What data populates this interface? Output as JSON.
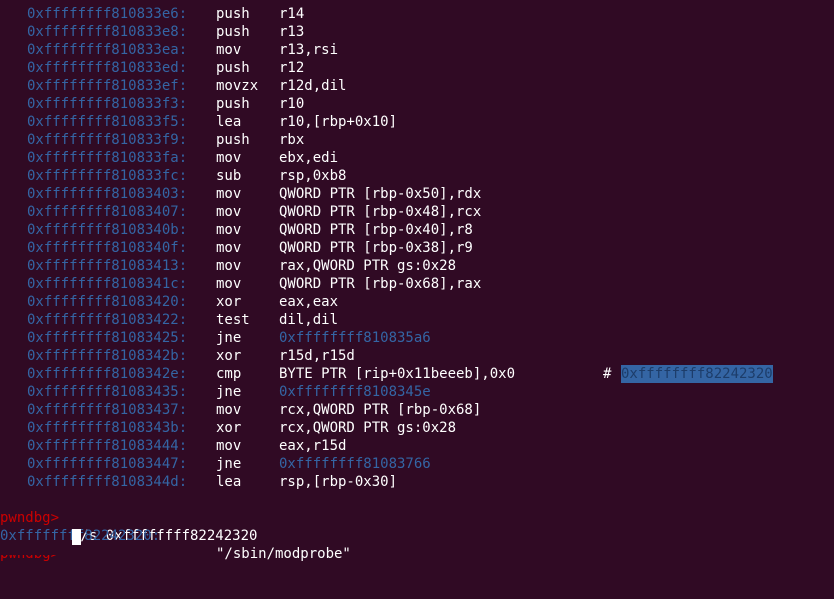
{
  "disassembly": [
    {
      "addr": "0xffffffff810833e6:",
      "mnem": "push",
      "ops": "r14"
    },
    {
      "addr": "0xffffffff810833e8:",
      "mnem": "push",
      "ops": "r13"
    },
    {
      "addr": "0xffffffff810833ea:",
      "mnem": "mov",
      "ops": "r13,rsi"
    },
    {
      "addr": "0xffffffff810833ed:",
      "mnem": "push",
      "ops": "r12"
    },
    {
      "addr": "0xffffffff810833ef:",
      "mnem": "movzx",
      "ops": "r12d,dil"
    },
    {
      "addr": "0xffffffff810833f3:",
      "mnem": "push",
      "ops": "r10"
    },
    {
      "addr": "0xffffffff810833f5:",
      "mnem": "lea",
      "ops": "r10,[rbp+0x10]"
    },
    {
      "addr": "0xffffffff810833f9:",
      "mnem": "push",
      "ops": "rbx"
    },
    {
      "addr": "0xffffffff810833fa:",
      "mnem": "mov",
      "ops": "ebx,edi"
    },
    {
      "addr": "0xffffffff810833fc:",
      "mnem": "sub",
      "ops": "rsp,0xb8"
    },
    {
      "addr": "0xffffffff81083403:",
      "mnem": "mov",
      "ops": "QWORD PTR [rbp-0x50],rdx"
    },
    {
      "addr": "0xffffffff81083407:",
      "mnem": "mov",
      "ops": "QWORD PTR [rbp-0x48],rcx"
    },
    {
      "addr": "0xffffffff8108340b:",
      "mnem": "mov",
      "ops": "QWORD PTR [rbp-0x40],r8"
    },
    {
      "addr": "0xffffffff8108340f:",
      "mnem": "mov",
      "ops": "QWORD PTR [rbp-0x38],r9"
    },
    {
      "addr": "0xffffffff81083413:",
      "mnem": "mov",
      "ops": "rax,QWORD PTR gs:0x28"
    },
    {
      "addr": "0xffffffff8108341c:",
      "mnem": "mov",
      "ops": "QWORD PTR [rbp-0x68],rax"
    },
    {
      "addr": "0xffffffff81083420:",
      "mnem": "xor",
      "ops": "eax,eax"
    },
    {
      "addr": "0xffffffff81083422:",
      "mnem": "test",
      "ops": "dil,dil"
    },
    {
      "addr": "0xffffffff81083425:",
      "mnem": "jne",
      "ops": "0xffffffff810835a6",
      "target": true
    },
    {
      "addr": "0xffffffff8108342b:",
      "mnem": "xor",
      "ops": "r15d,r15d"
    },
    {
      "addr": "0xffffffff8108342e:",
      "mnem": "cmp",
      "ops": "BYTE PTR [rip+0x11beeeb],0x0",
      "comment": "#",
      "highlight": "0xffffffff82242320"
    },
    {
      "addr": "0xffffffff81083435:",
      "mnem": "jne",
      "ops": "0xffffffff8108345e",
      "target": true
    },
    {
      "addr": "0xffffffff81083437:",
      "mnem": "mov",
      "ops": "rcx,QWORD PTR [rbp-0x68]"
    },
    {
      "addr": "0xffffffff8108343b:",
      "mnem": "xor",
      "ops": "rcx,QWORD PTR gs:0x28"
    },
    {
      "addr": "0xffffffff81083444:",
      "mnem": "mov",
      "ops": "eax,r15d"
    },
    {
      "addr": "0xffffffff81083447:",
      "mnem": "jne",
      "ops": "0xffffffff81083766",
      "target": true
    },
    {
      "addr": "0xffffffff8108344d:",
      "mnem": "lea",
      "ops": "rsp,[rbp-0x30]"
    }
  ],
  "prompt": {
    "label": "pwndbg>",
    "command": "x/s 0xffffffff82242320"
  },
  "output": {
    "addr": "0xffffffff82242320:",
    "value": "\"/sbin/modprobe\""
  },
  "last_prompt": {
    "label": "pwndbg>"
  },
  "colors": {
    "background": "#300a24",
    "address": "#3465a4",
    "prompt": "#cc0000",
    "text": "#ffffff"
  }
}
